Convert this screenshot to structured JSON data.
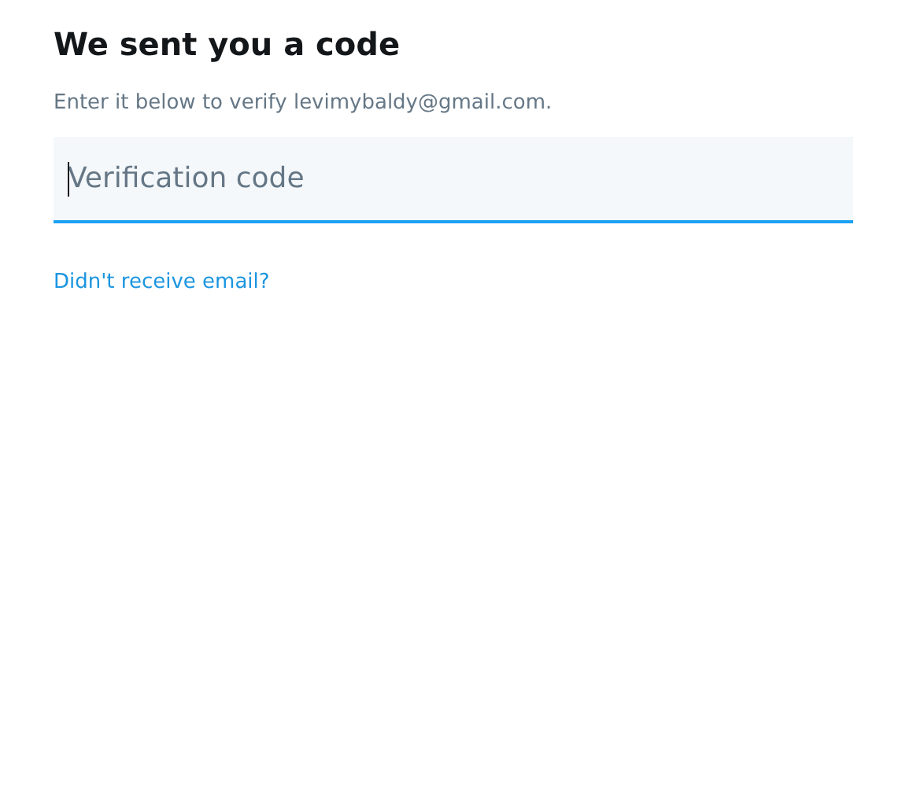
{
  "heading": "We sent you a code",
  "subtitle": "Enter it below to verify levimybaldy@gmail.com.",
  "code_field": {
    "placeholder": "Verification code",
    "focused": true
  },
  "link": "Didn't receive email?"
}
